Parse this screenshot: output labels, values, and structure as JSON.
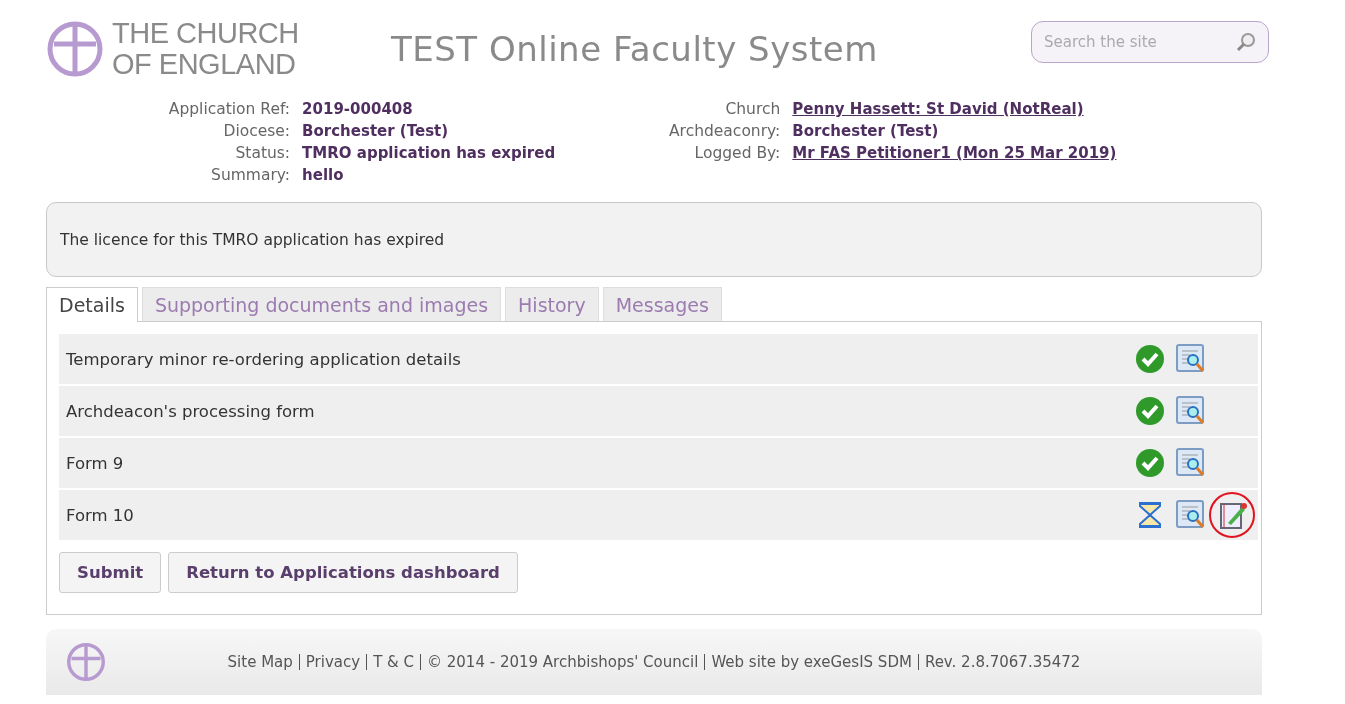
{
  "header": {
    "logo_lines": [
      "THE CHURCH",
      "OF ENGLAND"
    ],
    "title": "TEST Online Faculty System",
    "search": {
      "placeholder": "Search the site"
    }
  },
  "info_left": [
    {
      "label": "Application Ref:",
      "value": "2019-000408",
      "link": false
    },
    {
      "label": "Diocese:",
      "value": "Borchester (Test)",
      "link": false
    },
    {
      "label": "Status:",
      "value": "TMRO application has expired",
      "link": false
    },
    {
      "label": "Summary:",
      "value": "hello",
      "link": false
    }
  ],
  "info_right": [
    {
      "label": "Church",
      "value": "Penny Hassett: St David (NotReal)",
      "link": true
    },
    {
      "label": "Archdeaconry:",
      "value": "Borchester (Test)",
      "link": false
    },
    {
      "label": "Logged By:",
      "value": "Mr FAS Petitioner1 (Mon 25 Mar 2019)",
      "link": true
    }
  ],
  "notice": "The licence for this TMRO application has expired",
  "tabs": [
    {
      "label": "Details",
      "selected": true
    },
    {
      "label": "Supporting documents and images",
      "selected": false
    },
    {
      "label": "History",
      "selected": false
    },
    {
      "label": "Messages",
      "selected": false
    }
  ],
  "forms": [
    {
      "label": "Temporary minor re-ordering application details",
      "kind": "complete",
      "editable": false,
      "edit_highlighted": false
    },
    {
      "label": "Archdeacon's processing form",
      "kind": "complete",
      "editable": false,
      "edit_highlighted": false
    },
    {
      "label": "Form 9",
      "kind": "complete",
      "editable": false,
      "edit_highlighted": false
    },
    {
      "label": "Form 10",
      "kind": "pending",
      "editable": true,
      "edit_highlighted": true
    }
  ],
  "buttons": [
    "Submit",
    "Return to Applications dashboard"
  ],
  "footer": [
    "Site Map",
    "Privacy",
    "T & C",
    "© 2014 - 2019 Archbishops' Council",
    "Web site by exeGesIS SDM",
    "Rev. 2.8.7067.35472"
  ]
}
